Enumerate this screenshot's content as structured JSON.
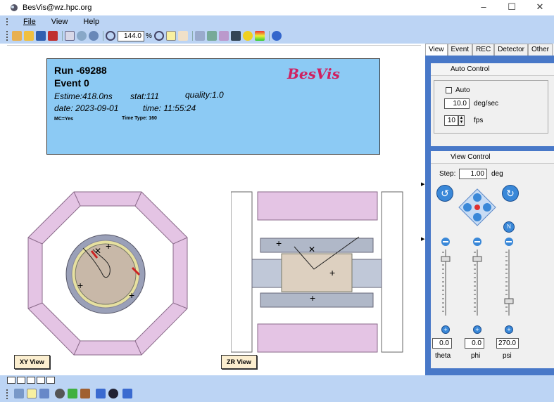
{
  "window": {
    "title": "BesVis@wz.hpc.org",
    "controls": [
      "–",
      "☐",
      "✕"
    ]
  },
  "menu": [
    "File",
    "View",
    "Help"
  ],
  "toolbar": {
    "zoom_value": "144.0",
    "zoom_unit": "%",
    "icons": [
      "open-folder-icon",
      "folder-icon",
      "save-icon",
      "close-file-icon",
      "doc-icon",
      "cd-icon",
      "ring-icon",
      "zoom-out-icon",
      "zoom-in-icon",
      "select-arrow-icon",
      "pan-hand-icon",
      "pick-icon",
      "home-icon",
      "fisheye-icon",
      "save-image-icon",
      "smiley-icon",
      "palette-icon",
      "help-icon"
    ]
  },
  "event": {
    "run": "Run -69288",
    "event": "Event 0",
    "estime": "Estime:418.0ns",
    "stat": "stat:111",
    "quality": "quality:1.0",
    "date": "date: 2023-09-01",
    "time": "time: 11:55:24",
    "mc": "MC=Yes",
    "time_type": "Time Type: 160",
    "logo": "BesVis"
  },
  "views": {
    "xy_label": "XY View",
    "zr_label": "ZR View"
  },
  "panel": {
    "tabs": [
      "View",
      "Event",
      "REC",
      "Detector",
      "Other"
    ],
    "auto_control": {
      "title": "Auto Control",
      "auto_label": "Auto",
      "auto_checked": false,
      "speed_value": "10.0",
      "speed_unit": "deg/sec",
      "fps_value": "10",
      "fps_unit": "fps"
    },
    "view_control": {
      "title": "View Control",
      "step_label": "Step:",
      "step_value": "1.00",
      "step_unit": "deg",
      "sliders": [
        {
          "name": "theta",
          "value": "0.0",
          "level_deg": 0
        },
        {
          "name": "phi",
          "value": "0.0",
          "level_deg": 0
        },
        {
          "name": "psi",
          "value": "270.0",
          "level_deg": 270
        }
      ]
    }
  },
  "colors": {
    "menubar": "#bcd4f4",
    "info_panel": "#8ccaf4",
    "panel_bg": "#4878c8",
    "logo": "#d02060",
    "outer_detector": "#e4c4e4",
    "track": "#222222"
  }
}
